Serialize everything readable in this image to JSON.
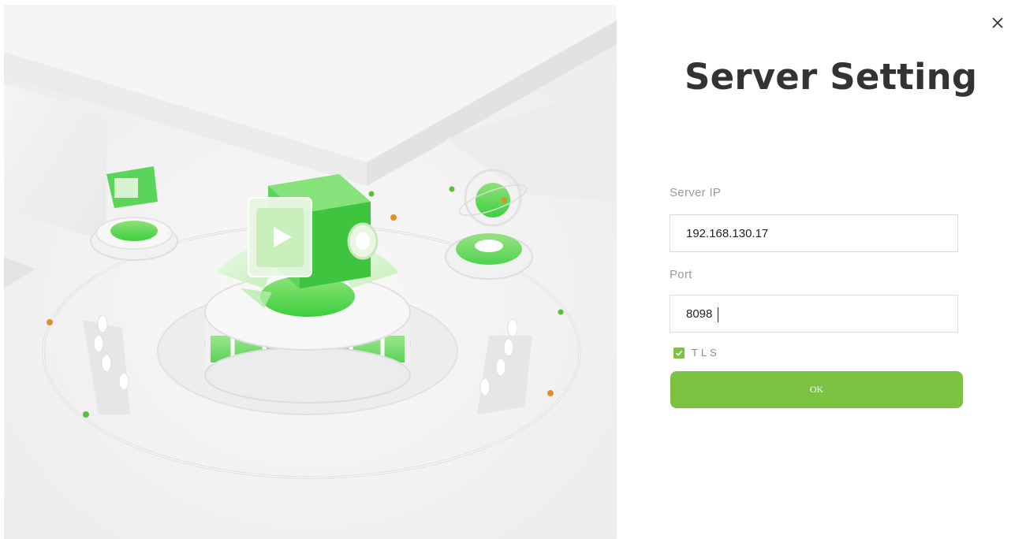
{
  "window": {
    "close_icon": "close-icon",
    "illustration": "camera-server-illustration"
  },
  "form": {
    "title": "Server Setting",
    "server_ip_label": "Server IP",
    "server_ip_value": "192.168.130.17",
    "port_label": "Port",
    "port_value": "8098",
    "tls_label": "TLS",
    "tls_checked": true,
    "ok_label": "OK"
  },
  "colors": {
    "accent": "#7cc242",
    "title": "#333333",
    "label": "#9a9a9a",
    "border": "#dcdcdc"
  }
}
